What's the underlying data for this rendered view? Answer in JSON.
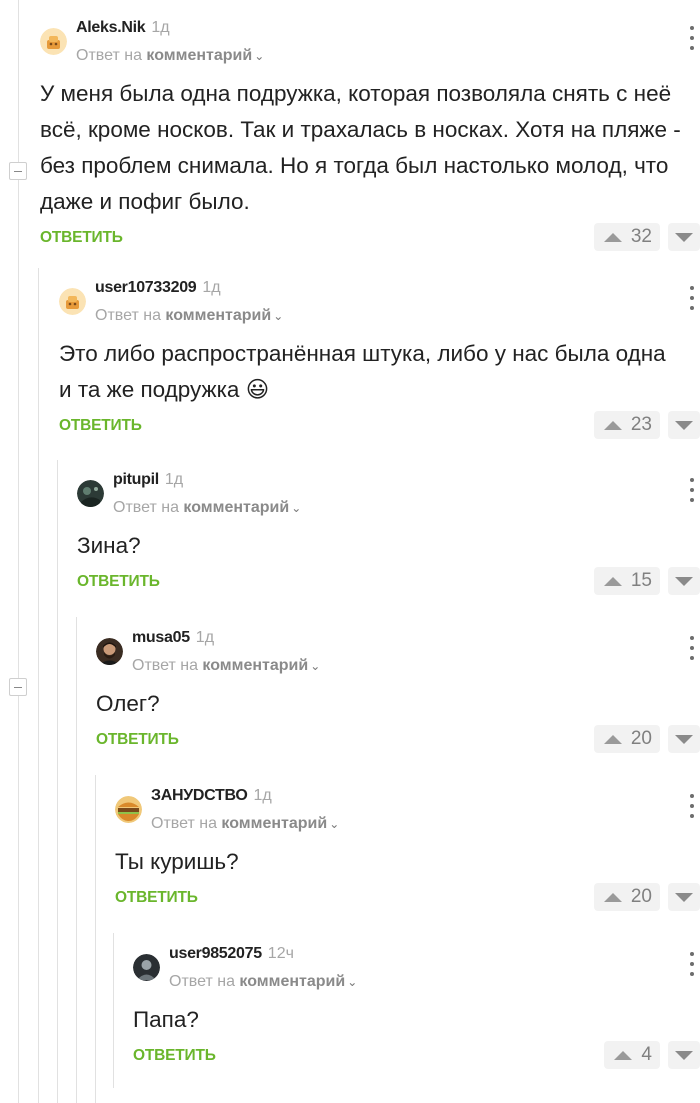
{
  "common": {
    "reply_prefix": "Ответ на",
    "reply_link": "комментарий",
    "reply_chevron": "⌄",
    "reply_button": "ОТВЕТИТЬ"
  },
  "comments": [
    {
      "author": "Aleks.Nik",
      "time": "1д",
      "text": "У меня была одна подружка, которая позволяла снять с неё всё, кроме носков. Так и трахалась в носках. Хотя на пляже - без проблем снимала. Но я тогда был настолько молод, что даже и пофиг было.",
      "votes": "32"
    },
    {
      "author": "user10733209",
      "time": "1д",
      "text": "Это либо распространённая штука, либо у нас была одна и та же подружка 😃",
      "votes": "23"
    },
    {
      "author": "pitupil",
      "time": "1д",
      "text": "Зина?",
      "votes": "15"
    },
    {
      "author": "musa05",
      "time": "1д",
      "text": "Олег?",
      "votes": "20"
    },
    {
      "author": "ЗАНУDСТВО",
      "time": "1д",
      "text": "Ты куришь?",
      "votes": "20"
    },
    {
      "author": "user9852075",
      "time": "12ч",
      "text": "Папа?",
      "votes": "4"
    }
  ]
}
